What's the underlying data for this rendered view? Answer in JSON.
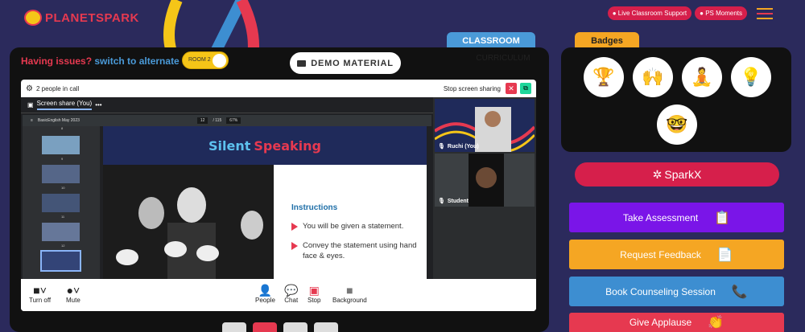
{
  "header": {
    "logo_text": "PLANETSPARK",
    "live_support": "Live Classroom Support",
    "ps_moments": "PS Moments"
  },
  "issues": {
    "prefix": "Having issues?",
    "link": "switch to alternate room"
  },
  "room_toggle": {
    "label": "ROOM 2"
  },
  "demo_material": "DEMO MATERIAL",
  "tabs": {
    "classroom": "CLASSROOM",
    "curriculum": "CURRICULUM"
  },
  "call": {
    "people_count": "2 people in call",
    "stop_sharing": "Stop screen sharing",
    "screen_share_label": "Screen share (You)",
    "pdf": {
      "filename": "BasicEnglish May 2023",
      "page": "12",
      "total": "/ 115",
      "zoom": "67%"
    },
    "slide": {
      "title_blue": "Silent",
      "title_red": "Speaking",
      "instructions_heading": "Instructions",
      "bullets": [
        "You will be given a statement.",
        "Convey the statement using hand face & eyes."
      ]
    },
    "participants": [
      {
        "name": "Ruchi (You)"
      },
      {
        "name": "Student"
      }
    ],
    "controls": {
      "turn_off": "Turn off",
      "mute": "Mute",
      "people": "People",
      "chat": "Chat",
      "stop": "Stop",
      "background": "Background"
    },
    "thumb_numbers": [
      "8",
      "9",
      "10",
      "11",
      "12"
    ]
  },
  "badges_title": "Badges",
  "sparkx": "SparkX",
  "actions": [
    {
      "label": "Take Assessment",
      "color": "#7a15e8",
      "icon": "clipboard-icon"
    },
    {
      "label": "Request Feedback",
      "color": "#f5a623",
      "icon": "document-icon"
    },
    {
      "label": "Book Counseling Session",
      "color": "#3d8ed1",
      "icon": "phone-icon"
    },
    {
      "label": "Give Applause",
      "color": "#e63950",
      "icon": "clap-icon"
    }
  ],
  "colors": {
    "background": "#2b2a5c",
    "accent_red": "#e63950",
    "accent_yellow": "#f5a623"
  }
}
